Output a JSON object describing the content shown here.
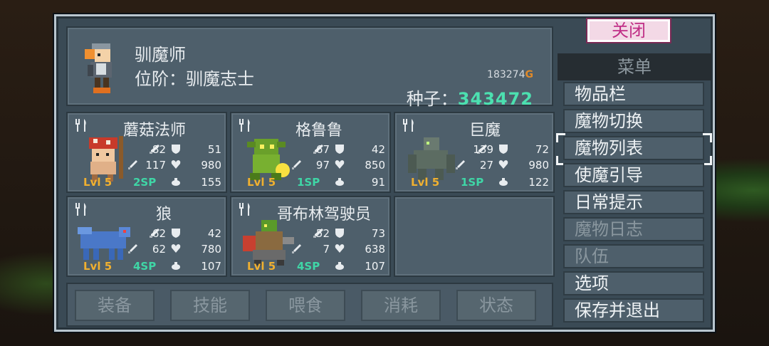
{
  "player": {
    "name": "驯魔师",
    "rank": "位阶：驯魔志士",
    "gold_value": "183274",
    "gold_suffix": "G",
    "seed_label": "种子：",
    "seed_value": "343472"
  },
  "monsters": [
    {
      "name": "蘑菇法师",
      "level": "Lvl 5",
      "sp": "2SP",
      "atk": "82",
      "def": "51",
      "matk": "117",
      "hp": "980",
      "mana": "155"
    },
    {
      "name": "格鲁鲁",
      "level": "Lvl 5",
      "sp": "1SP",
      "atk": "67",
      "def": "42",
      "matk": "97",
      "hp": "850",
      "mana": "91"
    },
    {
      "name": "巨魔",
      "level": "Lvl 5",
      "sp": "1SP",
      "atk": "139",
      "def": "72",
      "matk": "27",
      "hp": "980",
      "mana": "122"
    },
    {
      "name": "狼",
      "level": "Lvl 5",
      "sp": "4SP",
      "atk": "62",
      "def": "42",
      "matk": "62",
      "hp": "780",
      "mana": "107"
    },
    {
      "name": "哥布林驾驶员",
      "level": "Lvl 5",
      "sp": "4SP",
      "atk": "52",
      "def": "73",
      "matk": "7",
      "hp": "638",
      "mana": "107"
    }
  ],
  "actions": [
    "装备",
    "技能",
    "喂食",
    "消耗",
    "状态"
  ],
  "close_label": "关闭",
  "menu": {
    "title": "菜单",
    "items": [
      {
        "label": "物品栏",
        "enabled": true
      },
      {
        "label": "魔物切换",
        "enabled": true
      },
      {
        "label": "魔物列表",
        "enabled": true,
        "selected": true
      },
      {
        "label": "使魔引导",
        "enabled": true
      },
      {
        "label": "日常提示",
        "enabled": true
      },
      {
        "label": "魔物日志",
        "enabled": false
      },
      {
        "label": "队伍",
        "enabled": false
      },
      {
        "label": "选项",
        "enabled": true
      },
      {
        "label": "保存并退出",
        "enabled": true
      }
    ]
  },
  "colors": {
    "level": "#f0b030",
    "sp": "#3fd6a6",
    "seed": "#4ce0b0",
    "gold": "#e08a2a",
    "close_text": "#c02e86"
  },
  "icons": {
    "fork": "fork-knife-icon",
    "attack": "sword-icon",
    "defense": "shield-icon",
    "magic": "wand-icon",
    "health": "heart-icon",
    "mana": "drop-icon"
  }
}
